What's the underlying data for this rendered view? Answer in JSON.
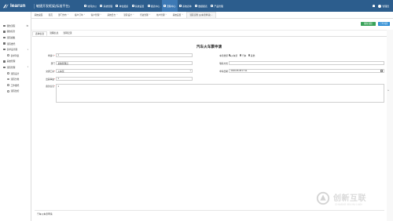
{
  "brand": {
    "logo_text": "learun",
    "system_name": "敏捷开发框架(标准平台)"
  },
  "topnav": [
    {
      "label": "协同办公",
      "icon": "grid-icon",
      "active": false
    },
    {
      "label": "系统管理",
      "icon": "gear-icon",
      "active": false
    },
    {
      "label": "单位组织",
      "icon": "org-icon",
      "active": false
    },
    {
      "label": "系统设置",
      "icon": "monitor-icon",
      "active": false
    },
    {
      "label": "报表中心",
      "icon": "chart-icon",
      "active": false
    },
    {
      "label": "流程中心",
      "icon": "flow-icon",
      "active": true
    },
    {
      "label": "系统表单",
      "icon": "form-icon",
      "active": false
    },
    {
      "label": "数据报表",
      "icon": "report-icon",
      "active": false
    },
    {
      "label": "产品管理",
      "icon": "product-icon",
      "active": false
    }
  ],
  "user": {
    "name": "管理员"
  },
  "sidebar": {
    "items": [
      {
        "label": "我的流程",
        "sub": false
      },
      {
        "label": "我的任务",
        "sub": false
      },
      {
        "label": "流程模板",
        "sub": false
      },
      {
        "label": "流程委托",
        "sub": false
      },
      {
        "label": "表单设计器",
        "sub": false
      },
      {
        "label": "表单列表",
        "sub": true
      },
      {
        "label": "系统管理",
        "sub": false
      },
      {
        "label": "流程管理",
        "sub": false
      },
      {
        "label": "流程设计",
        "sub": true
      },
      {
        "label": "流程分类",
        "sub": true
      },
      {
        "label": "工作委托",
        "sub": true
      },
      {
        "label": "流程监控",
        "sub": true
      }
    ]
  },
  "tabs": [
    "系统桌面",
    "首页",
    "部门分布",
    "客户订单",
    "客户管理",
    "系统日志",
    "流程设计",
    "行政管理",
    "用户管理",
    "系统设置",
    "流程实例 [火车票申请]"
  ],
  "toolbar": {
    "save_label": "保存流程",
    "print_label": "打印流程"
  },
  "subtabs": [
    "表单信息",
    "流程信息",
    "流转记录"
  ],
  "form": {
    "title": "汽车火车票申请",
    "fields": {
      "applicant_label": "申请人",
      "applicant_value": "1",
      "type_label": "车票类型",
      "type_options": [
        "火车票",
        "汽车",
        "其他"
      ],
      "type_selected": 0,
      "dept_label": "部门",
      "dept_value": "系统管理员",
      "phone_label": "联系方式",
      "phone_value": "",
      "traffic_label": "交通工具",
      "traffic_value": "火车票",
      "date_label": "申请日期",
      "date_value": "2020-06-08 17:11",
      "reason_label": "出差事由",
      "reason_value": "1",
      "remark_label": "备注信息",
      "remark_value": "1"
    }
  },
  "bottom_note": "汽车火车票申请",
  "watermark": {
    "text": "创新互联",
    "sub": "CHUANG XIN HU LIAN"
  },
  "colors": {
    "topbar": "#2c5d8d",
    "active_nav": "#3d79b5",
    "save": "#3aa35a",
    "print": "#2a8bd4"
  }
}
